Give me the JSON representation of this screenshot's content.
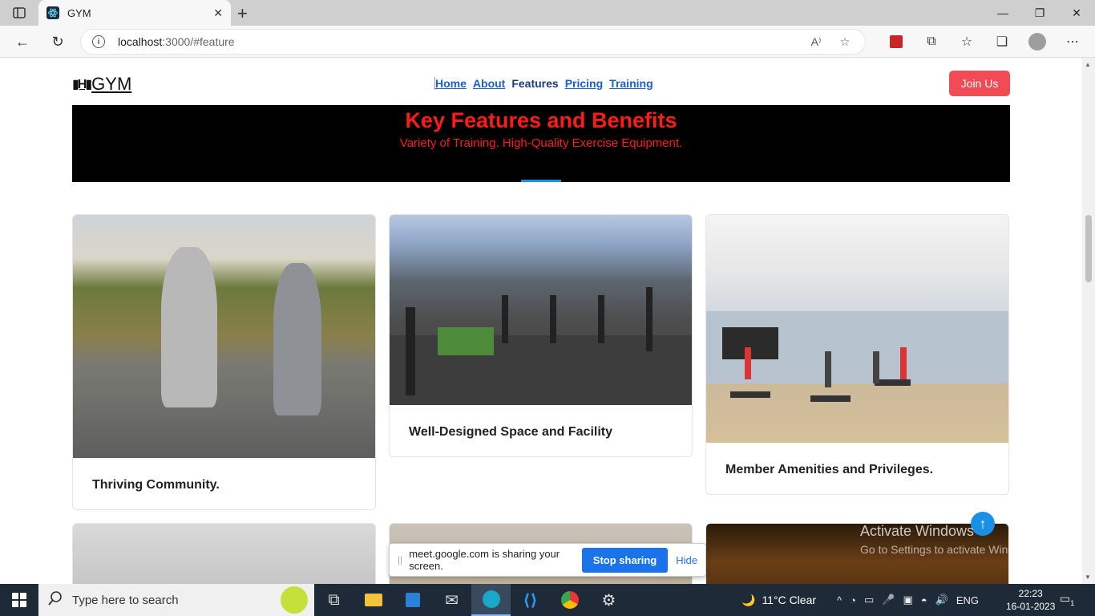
{
  "browser": {
    "tab_title": "GYM",
    "url_host": "localhost",
    "url_rest": ":3000/#feature",
    "read_aloud_label": "A⁾"
  },
  "site": {
    "logo_text": "GYM",
    "nav": [
      "Home",
      "About",
      "Features",
      "Pricing",
      "Training"
    ],
    "join_label": "Join Us"
  },
  "banner": {
    "title": "Key Features and Benefits",
    "subtitle": "Variety of Training. High-Quality Exercise Equipment."
  },
  "cards": [
    {
      "caption": "Thriving Community."
    },
    {
      "caption": "Well-Designed Space and Facility"
    },
    {
      "caption": "Member Amenities and Privileges."
    }
  ],
  "share": {
    "message": "meet.google.com is sharing your screen.",
    "stop_label": "Stop sharing",
    "hide_label": "Hide"
  },
  "watermark": {
    "line1": "Activate Windows",
    "line2": "Go to Settings to activate Windows."
  },
  "taskbar": {
    "search_placeholder": "Type here to search",
    "weather": "11°C  Clear",
    "lang": "ENG",
    "time": "22:23",
    "date": "16-01-2023",
    "notif_count": "1"
  }
}
